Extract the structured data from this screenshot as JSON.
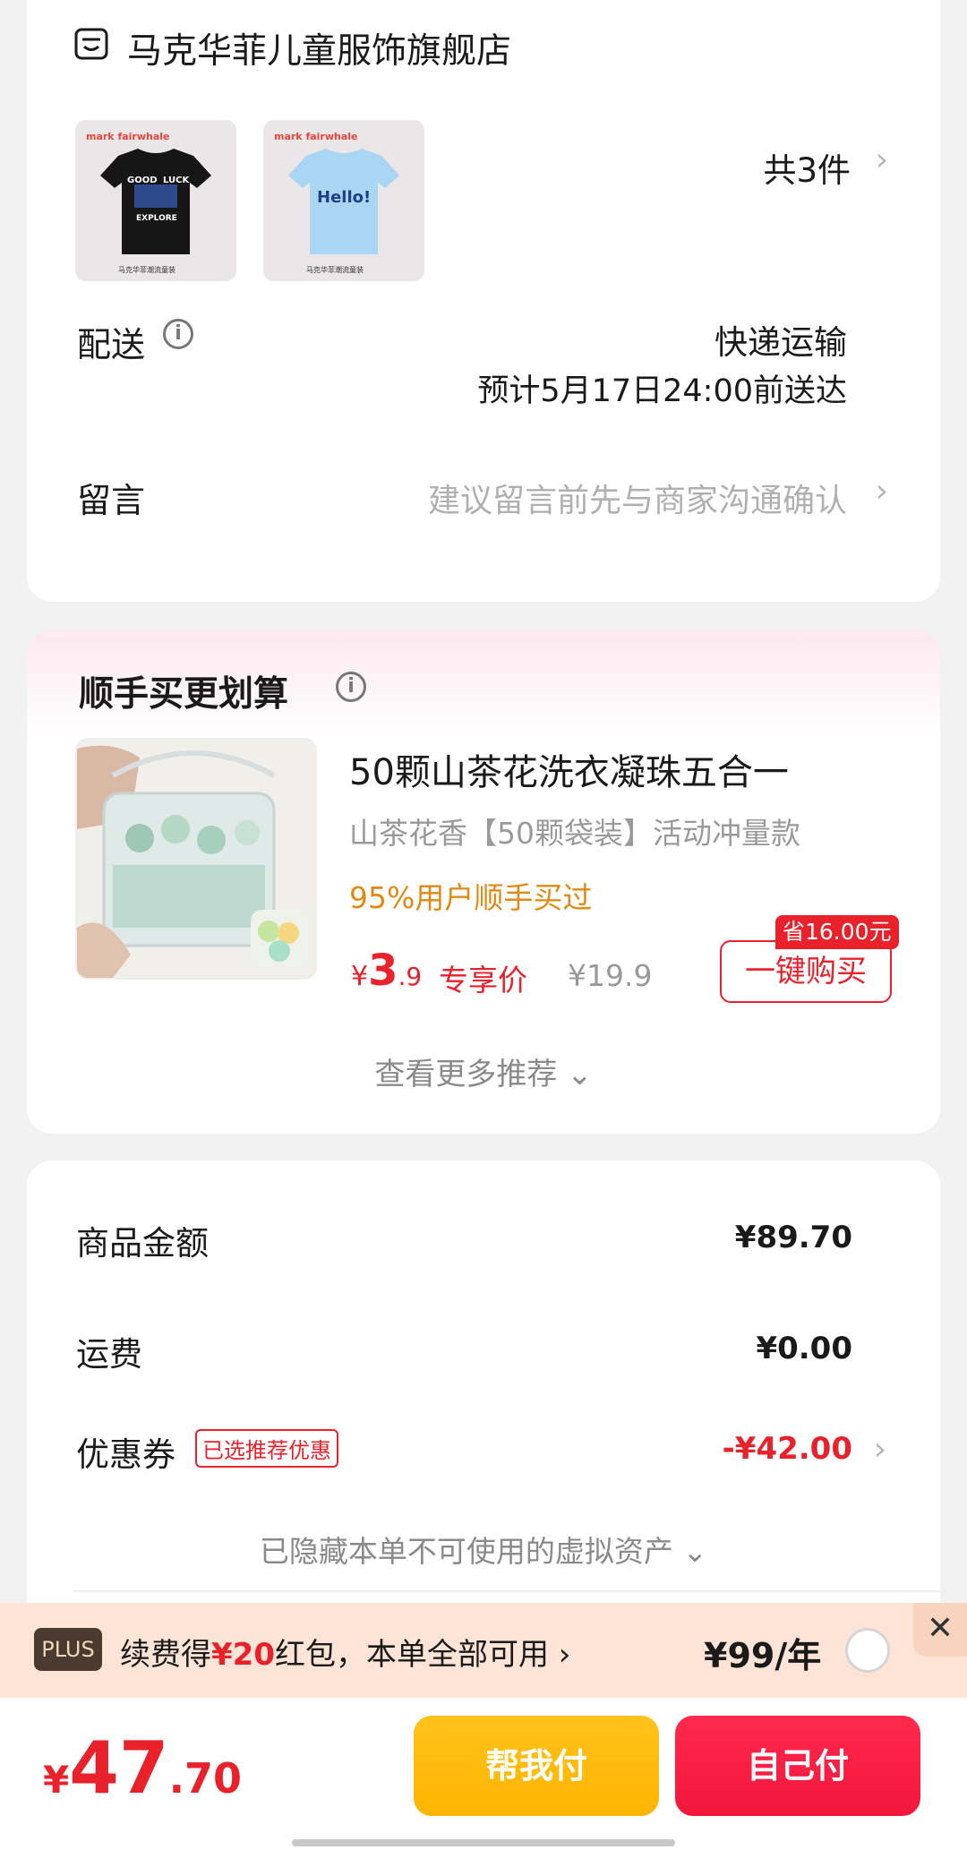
{
  "store": {
    "name": "马克华菲儿童服饰旗舰店",
    "item_count": "共3件",
    "thumb_1_brand": "mark fairwhale",
    "thumb_1_print_top": "GOOD",
    "thumb_1_print_luck": "LUCK",
    "thumb_1_print_bottom": "EXPLORE",
    "thumb_2_brand": "mark fairwhale",
    "thumb_2_print": "Hello!",
    "thumb_caption": "马克华菲潮流童装"
  },
  "delivery": {
    "label": "配送",
    "method": "快递运输",
    "eta": "预计5月17日24:00前送达"
  },
  "message": {
    "label": "留言",
    "placeholder": "建议留言前先与商家沟通确认"
  },
  "recommend": {
    "title": "顺手买更划算",
    "product_name": "50颗山茶花洗衣凝珠五合一",
    "spec": "山茶花香【50颗袋装】活动冲量款",
    "social_proof": "95%用户顺手买过",
    "price_currency": "¥",
    "price_int": "3",
    "price_dec": ".9",
    "price_tag": "专享价",
    "original_price": "¥19.9",
    "save_badge": "省16.00元",
    "buy_label": "一键购买",
    "more_label": "查看更多推荐 ⌄"
  },
  "summary": {
    "goods_label": "商品金额",
    "goods_value": "¥89.70",
    "shipping_label": "运费",
    "shipping_value": "¥0.00",
    "coupon_label": "优惠券",
    "coupon_badge": "已选推荐优惠",
    "coupon_value": "-¥42.00",
    "hidden_assets": "已隐藏本单不可使用的虚拟资产 ⌄"
  },
  "plus": {
    "badge": "PLUS",
    "text_pre": "续费得",
    "text_highlight": "¥20",
    "text_post": "红包，本单全部可用",
    "text_chevron": "›",
    "price": "¥99/年",
    "close": "✕"
  },
  "footer": {
    "currency": "¥",
    "total_int": "47",
    "total_dec": ".70",
    "help_pay": "帮我付",
    "self_pay": "自己付"
  },
  "colors": {
    "accent_red": "#e8212b",
    "help_pay_yellow": "#ffb400",
    "self_pay_red": "#f2163c"
  }
}
